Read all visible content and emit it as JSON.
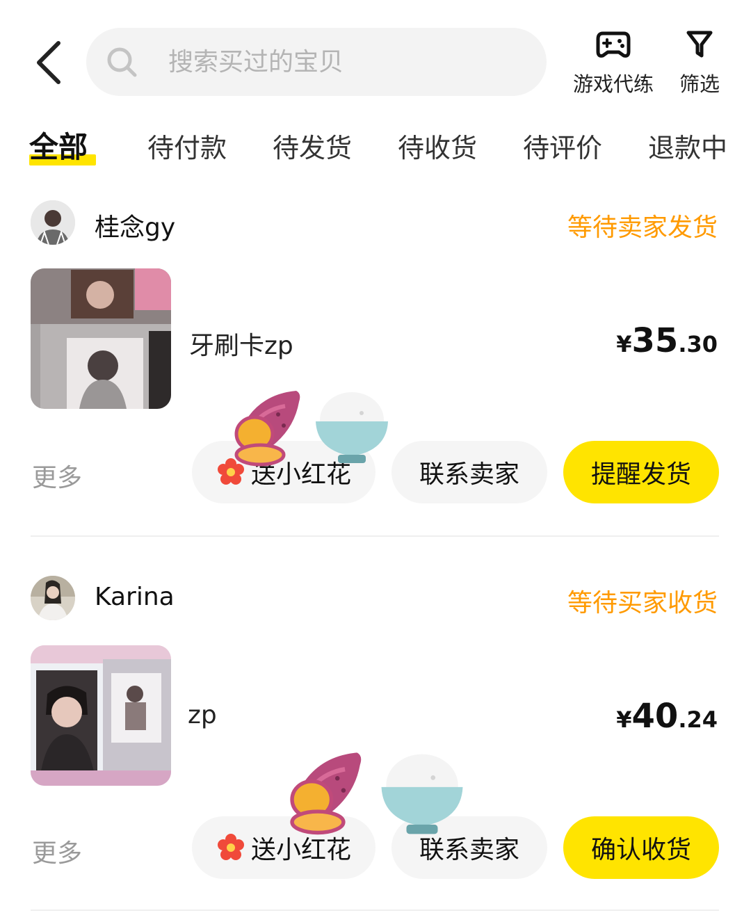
{
  "header": {
    "search_placeholder": "搜索买过的宝贝",
    "game_label": "游戏代练",
    "filter_label": "筛选"
  },
  "tabs": [
    {
      "label": "全部",
      "active": true
    },
    {
      "label": "待付款"
    },
    {
      "label": "待发货"
    },
    {
      "label": "待收货"
    },
    {
      "label": "待评价"
    },
    {
      "label": "退款中"
    }
  ],
  "orders": [
    {
      "seller": "桂念gy",
      "status": "等待卖家发货",
      "title": "牙刷卡zp",
      "price": {
        "currency": "¥",
        "int": "35",
        "dec": ".30"
      },
      "more": "更多",
      "buttons": {
        "flower": "送小红花",
        "contact": "联系卖家",
        "primary": "提醒发货"
      }
    },
    {
      "seller": "Karina",
      "status": "等待买家收货",
      "title": "zp",
      "price": {
        "currency": "¥",
        "int": "40",
        "dec": ".24"
      },
      "more": "更多",
      "buttons": {
        "flower": "送小红花",
        "contact": "联系卖家",
        "primary": "确认收货"
      }
    }
  ],
  "colors": {
    "accent": "#ffe400",
    "status": "#ff9a00",
    "button_bg": "#f5f5f5"
  }
}
